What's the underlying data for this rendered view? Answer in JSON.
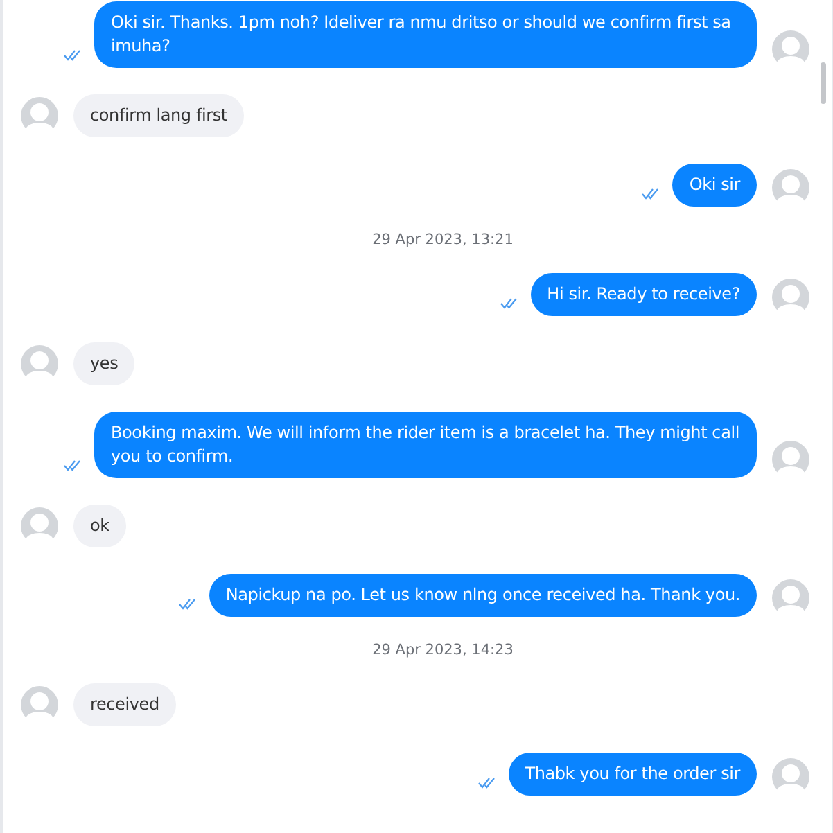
{
  "messages": [
    {
      "kind": "outgoing",
      "text": "Oki sir. Thanks. 1pm noh? Ideliver ra nmu dritso or should we confirm first sa imuha?"
    },
    {
      "kind": "incoming",
      "text": "confirm lang first"
    },
    {
      "kind": "outgoing",
      "text": "Oki sir"
    },
    {
      "kind": "date",
      "text": "29 Apr 2023, 13:21"
    },
    {
      "kind": "outgoing",
      "text": "Hi sir. Ready to receive?"
    },
    {
      "kind": "incoming",
      "text": "yes"
    },
    {
      "kind": "outgoing",
      "text": "Booking maxim. We will inform the rider item is a bracelet ha. They might call you to confirm."
    },
    {
      "kind": "incoming",
      "text": "ok"
    },
    {
      "kind": "outgoing",
      "text": "Napickup na po. Let us know nlng once received ha. Thank you."
    },
    {
      "kind": "date",
      "text": "29 Apr 2023, 14:23"
    },
    {
      "kind": "incoming",
      "text": "received"
    },
    {
      "kind": "outgoing",
      "text": "Thabk you for the order sir"
    }
  ]
}
